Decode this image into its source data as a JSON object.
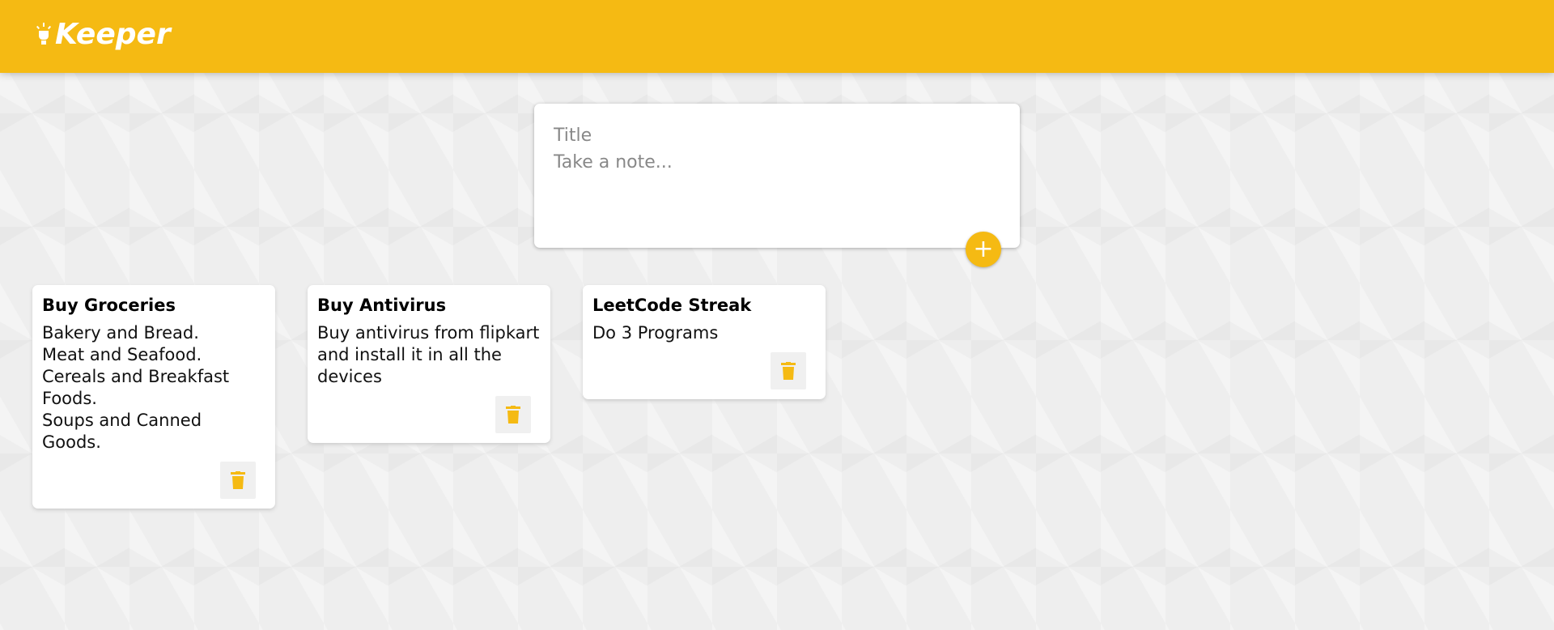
{
  "header": {
    "title": "Keeper"
  },
  "create_note": {
    "title_placeholder": "Title",
    "content_placeholder": "Take a note...",
    "add_button_label": "+"
  },
  "notes": [
    {
      "title": "Buy Groceries",
      "content": "Bakery and Bread.\nMeat and Seafood.\nCereals and Breakfast Foods.\nSoups and Canned Goods."
    },
    {
      "title": "Buy Antivirus",
      "content": "Buy antivirus from flipkart and install it in all the devices"
    },
    {
      "title": "LeetCode Streak",
      "content": "Do 3 Programs"
    }
  ],
  "icons": {
    "brand": "lightbulb-icon",
    "delete": "trash-icon"
  },
  "colors": {
    "accent": "#f5ba13",
    "background": "#eeeeee",
    "card": "#ffffff",
    "delete_button_bg": "#f0f0f0"
  }
}
